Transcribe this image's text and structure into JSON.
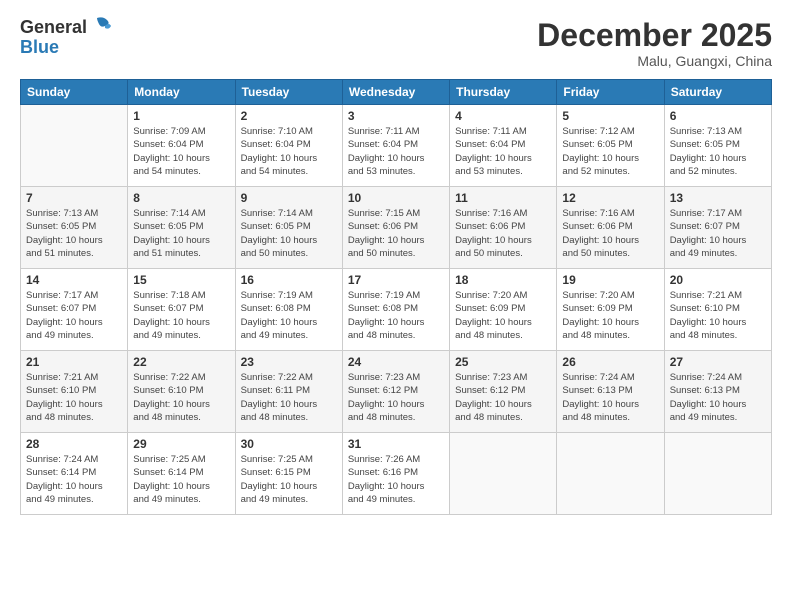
{
  "header": {
    "logo_general": "General",
    "logo_blue": "Blue",
    "month_year": "December 2025",
    "location": "Malu, Guangxi, China"
  },
  "days_of_week": [
    "Sunday",
    "Monday",
    "Tuesday",
    "Wednesday",
    "Thursday",
    "Friday",
    "Saturday"
  ],
  "weeks": [
    [
      {
        "day": "",
        "info": ""
      },
      {
        "day": "1",
        "info": "Sunrise: 7:09 AM\nSunset: 6:04 PM\nDaylight: 10 hours\nand 54 minutes."
      },
      {
        "day": "2",
        "info": "Sunrise: 7:10 AM\nSunset: 6:04 PM\nDaylight: 10 hours\nand 54 minutes."
      },
      {
        "day": "3",
        "info": "Sunrise: 7:11 AM\nSunset: 6:04 PM\nDaylight: 10 hours\nand 53 minutes."
      },
      {
        "day": "4",
        "info": "Sunrise: 7:11 AM\nSunset: 6:04 PM\nDaylight: 10 hours\nand 53 minutes."
      },
      {
        "day": "5",
        "info": "Sunrise: 7:12 AM\nSunset: 6:05 PM\nDaylight: 10 hours\nand 52 minutes."
      },
      {
        "day": "6",
        "info": "Sunrise: 7:13 AM\nSunset: 6:05 PM\nDaylight: 10 hours\nand 52 minutes."
      }
    ],
    [
      {
        "day": "7",
        "info": "Sunrise: 7:13 AM\nSunset: 6:05 PM\nDaylight: 10 hours\nand 51 minutes."
      },
      {
        "day": "8",
        "info": "Sunrise: 7:14 AM\nSunset: 6:05 PM\nDaylight: 10 hours\nand 51 minutes."
      },
      {
        "day": "9",
        "info": "Sunrise: 7:14 AM\nSunset: 6:05 PM\nDaylight: 10 hours\nand 50 minutes."
      },
      {
        "day": "10",
        "info": "Sunrise: 7:15 AM\nSunset: 6:06 PM\nDaylight: 10 hours\nand 50 minutes."
      },
      {
        "day": "11",
        "info": "Sunrise: 7:16 AM\nSunset: 6:06 PM\nDaylight: 10 hours\nand 50 minutes."
      },
      {
        "day": "12",
        "info": "Sunrise: 7:16 AM\nSunset: 6:06 PM\nDaylight: 10 hours\nand 50 minutes."
      },
      {
        "day": "13",
        "info": "Sunrise: 7:17 AM\nSunset: 6:07 PM\nDaylight: 10 hours\nand 49 minutes."
      }
    ],
    [
      {
        "day": "14",
        "info": "Sunrise: 7:17 AM\nSunset: 6:07 PM\nDaylight: 10 hours\nand 49 minutes."
      },
      {
        "day": "15",
        "info": "Sunrise: 7:18 AM\nSunset: 6:07 PM\nDaylight: 10 hours\nand 49 minutes."
      },
      {
        "day": "16",
        "info": "Sunrise: 7:19 AM\nSunset: 6:08 PM\nDaylight: 10 hours\nand 49 minutes."
      },
      {
        "day": "17",
        "info": "Sunrise: 7:19 AM\nSunset: 6:08 PM\nDaylight: 10 hours\nand 48 minutes."
      },
      {
        "day": "18",
        "info": "Sunrise: 7:20 AM\nSunset: 6:09 PM\nDaylight: 10 hours\nand 48 minutes."
      },
      {
        "day": "19",
        "info": "Sunrise: 7:20 AM\nSunset: 6:09 PM\nDaylight: 10 hours\nand 48 minutes."
      },
      {
        "day": "20",
        "info": "Sunrise: 7:21 AM\nSunset: 6:10 PM\nDaylight: 10 hours\nand 48 minutes."
      }
    ],
    [
      {
        "day": "21",
        "info": "Sunrise: 7:21 AM\nSunset: 6:10 PM\nDaylight: 10 hours\nand 48 minutes."
      },
      {
        "day": "22",
        "info": "Sunrise: 7:22 AM\nSunset: 6:10 PM\nDaylight: 10 hours\nand 48 minutes."
      },
      {
        "day": "23",
        "info": "Sunrise: 7:22 AM\nSunset: 6:11 PM\nDaylight: 10 hours\nand 48 minutes."
      },
      {
        "day": "24",
        "info": "Sunrise: 7:23 AM\nSunset: 6:12 PM\nDaylight: 10 hours\nand 48 minutes."
      },
      {
        "day": "25",
        "info": "Sunrise: 7:23 AM\nSunset: 6:12 PM\nDaylight: 10 hours\nand 48 minutes."
      },
      {
        "day": "26",
        "info": "Sunrise: 7:24 AM\nSunset: 6:13 PM\nDaylight: 10 hours\nand 48 minutes."
      },
      {
        "day": "27",
        "info": "Sunrise: 7:24 AM\nSunset: 6:13 PM\nDaylight: 10 hours\nand 49 minutes."
      }
    ],
    [
      {
        "day": "28",
        "info": "Sunrise: 7:24 AM\nSunset: 6:14 PM\nDaylight: 10 hours\nand 49 minutes."
      },
      {
        "day": "29",
        "info": "Sunrise: 7:25 AM\nSunset: 6:14 PM\nDaylight: 10 hours\nand 49 minutes."
      },
      {
        "day": "30",
        "info": "Sunrise: 7:25 AM\nSunset: 6:15 PM\nDaylight: 10 hours\nand 49 minutes."
      },
      {
        "day": "31",
        "info": "Sunrise: 7:26 AM\nSunset: 6:16 PM\nDaylight: 10 hours\nand 49 minutes."
      },
      {
        "day": "",
        "info": ""
      },
      {
        "day": "",
        "info": ""
      },
      {
        "day": "",
        "info": ""
      }
    ]
  ]
}
